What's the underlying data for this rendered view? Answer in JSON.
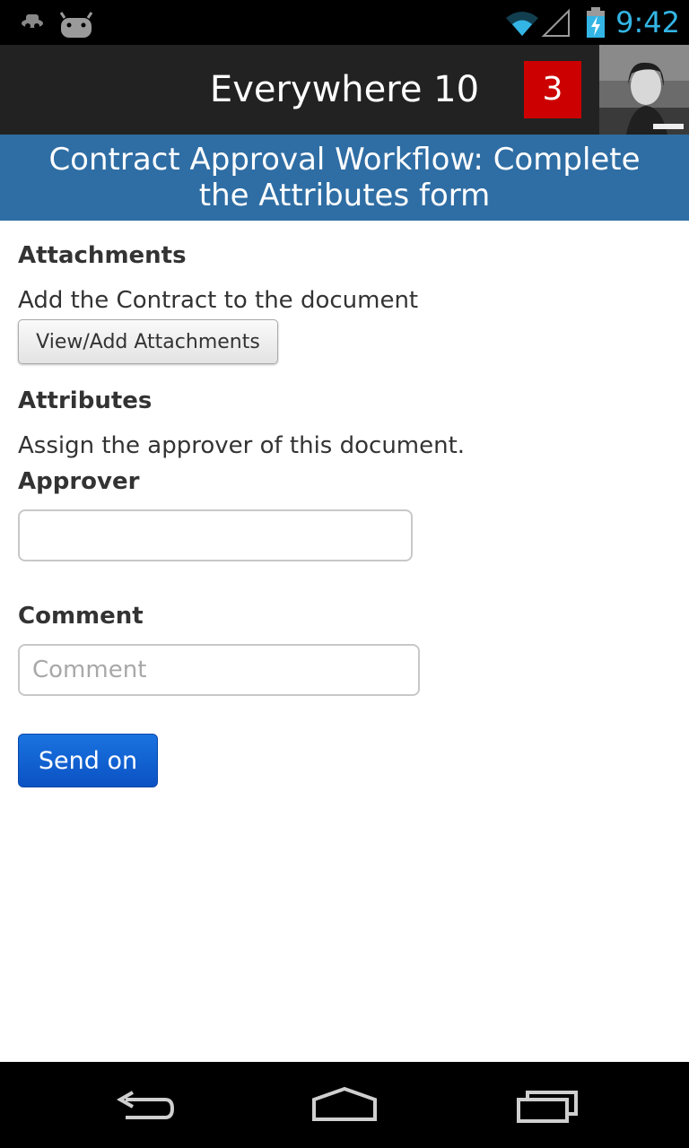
{
  "status_bar": {
    "time": "9:42",
    "icons": [
      "incognito-icon",
      "android-icon",
      "wifi-icon",
      "signal-icon",
      "battery-charging-icon"
    ]
  },
  "action_bar": {
    "title": "Everywhere 10",
    "badge_count": "3",
    "avatar": "user-avatar"
  },
  "banner": {
    "title": "Contract Approval Workflow: Complete the Attributes form"
  },
  "form": {
    "attachments": {
      "heading": "Attachments",
      "description": "Add the Contract to the document",
      "button_label": "View/Add Attachments"
    },
    "attributes": {
      "heading": "Attributes",
      "description": "Assign the approver of this document."
    },
    "approver": {
      "label": "Approver",
      "value": "",
      "placeholder": ""
    },
    "comment": {
      "label": "Comment",
      "value": "",
      "placeholder": "Comment"
    },
    "send_label": "Send on"
  },
  "nav_bar": {
    "icons": [
      "back-icon",
      "home-icon",
      "recent-apps-icon"
    ]
  },
  "colors": {
    "banner": "#2f6ea4",
    "badge": "#cc0000",
    "action_bar": "#222222",
    "clock": "#33b5e5",
    "send_button": "#0b52c4"
  }
}
